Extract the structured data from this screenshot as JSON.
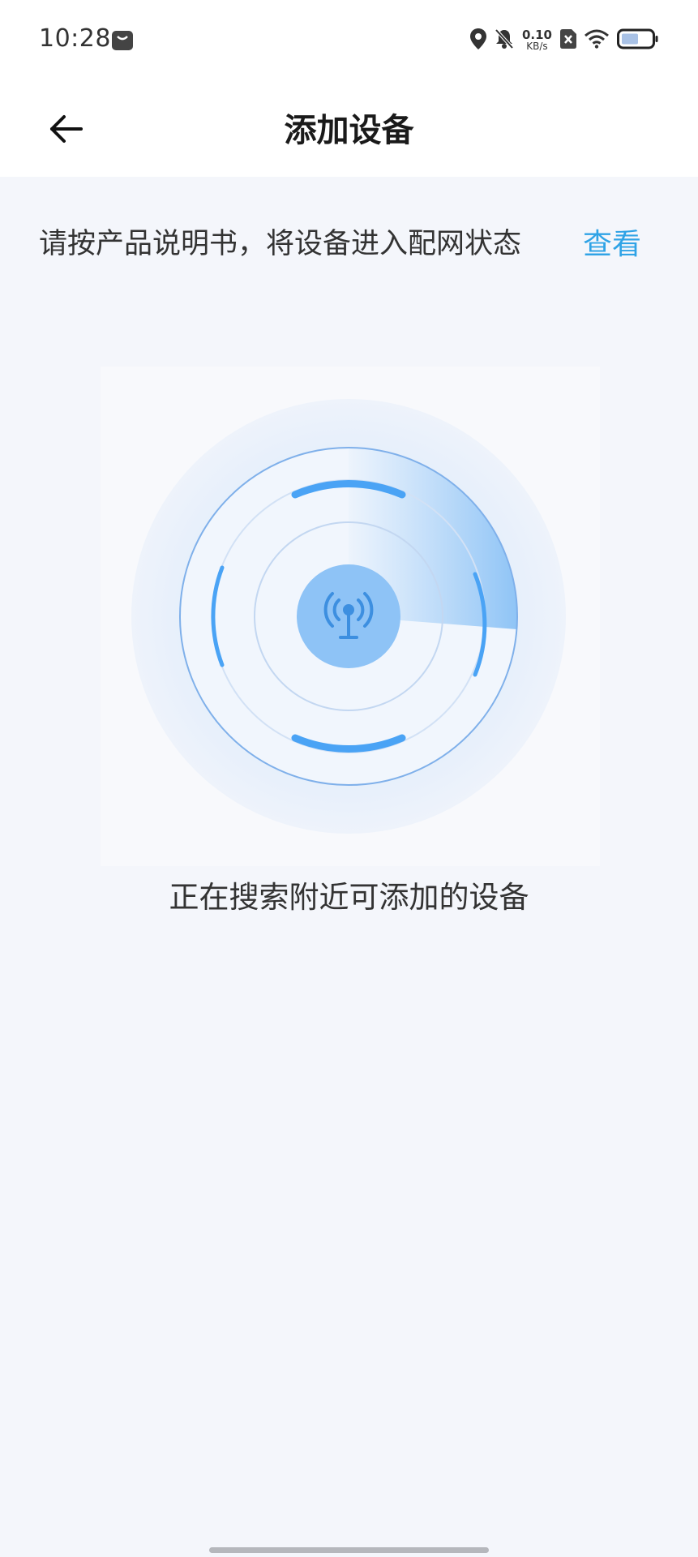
{
  "status_bar": {
    "time": "10:28",
    "net_speed_value": "0.10",
    "net_speed_unit": "KB/s",
    "icons": [
      "message-icon",
      "location-icon",
      "mute-icon",
      "sim-off-icon",
      "wifi-icon",
      "battery-icon"
    ]
  },
  "header": {
    "title": "添加设备"
  },
  "instruction": {
    "text": "请按产品说明书，将设备进入配网状态",
    "link_label": "查看"
  },
  "radar": {
    "status_text": "正在搜索附近可添加的设备",
    "center_icon": "antenna-icon",
    "accent_color": "#4aa3f5"
  },
  "colors": {
    "link": "#2fa3e6",
    "background": "#f4f6fb"
  }
}
